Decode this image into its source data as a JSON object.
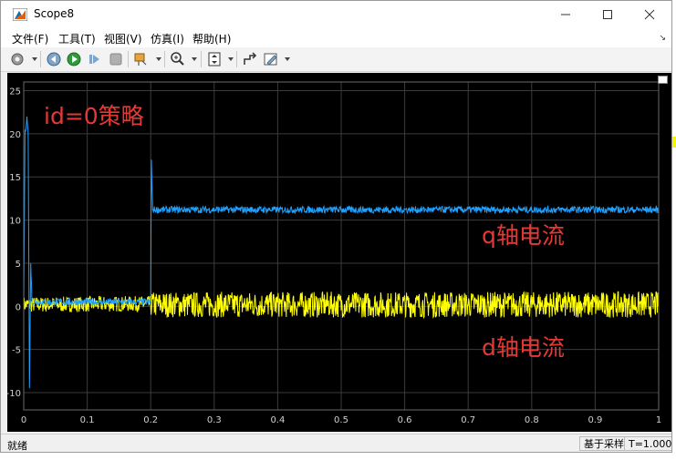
{
  "window": {
    "title": "Scope8",
    "controls": [
      "minimize",
      "maximize",
      "close"
    ]
  },
  "menu": {
    "items": [
      "文件(F)",
      "工具(T)",
      "视图(V)",
      "仿真(I)",
      "帮助(H)"
    ]
  },
  "toolbar": {
    "buttons": [
      "settings-icon",
      "step-back-icon",
      "run-icon",
      "step-forward-icon",
      "stop-icon",
      "highlight-icon",
      "zoom-icon",
      "fit-icon",
      "restore-icon",
      "edit-icon"
    ]
  },
  "annotations": {
    "strategy": "id=0策略",
    "q_label": "q轴电流",
    "d_label": "d轴电流"
  },
  "status": {
    "left": "就绪",
    "sample_mode": "基于采样",
    "time": "T=1.000"
  },
  "colors": {
    "q_series": "#1ea0ff",
    "d_series": "#ffff00",
    "annotation": "#e53935",
    "background": "#000000",
    "grid": "#3c3c3c"
  },
  "chart_data": {
    "type": "line",
    "xlim": [
      0,
      1
    ],
    "ylim": [
      -12,
      26
    ],
    "x_ticks": [
      "0",
      "0.1",
      "0.2",
      "0.3",
      "0.4",
      "0.5",
      "0.6",
      "0.7",
      "0.8",
      "0.9",
      "1"
    ],
    "y_ticks": [
      "25",
      "20",
      "15",
      "10",
      "5",
      "0",
      "-5",
      "-10"
    ],
    "grid": true,
    "series": [
      {
        "name": "q轴电流",
        "points": [
          [
            0,
            0
          ],
          [
            0.002,
            20
          ],
          [
            0.005,
            22
          ],
          [
            0.007,
            20
          ],
          [
            0.008,
            5
          ],
          [
            0.009,
            -9.5
          ],
          [
            0.011,
            5
          ],
          [
            0.013,
            0.5
          ],
          [
            0.2,
            0.5
          ],
          [
            0.201,
            17
          ],
          [
            0.203,
            11.2
          ],
          [
            1.0,
            11.2
          ]
        ],
        "noise": 0.4
      },
      {
        "name": "d轴电流",
        "points": [
          [
            0,
            0.2
          ],
          [
            0.01,
            0.2
          ],
          [
            0.2,
            0.3
          ],
          [
            0.205,
            0.2
          ],
          [
            1.0,
            0.2
          ]
        ],
        "noise_before": 0.9,
        "noise_after": 1.5
      }
    ]
  }
}
